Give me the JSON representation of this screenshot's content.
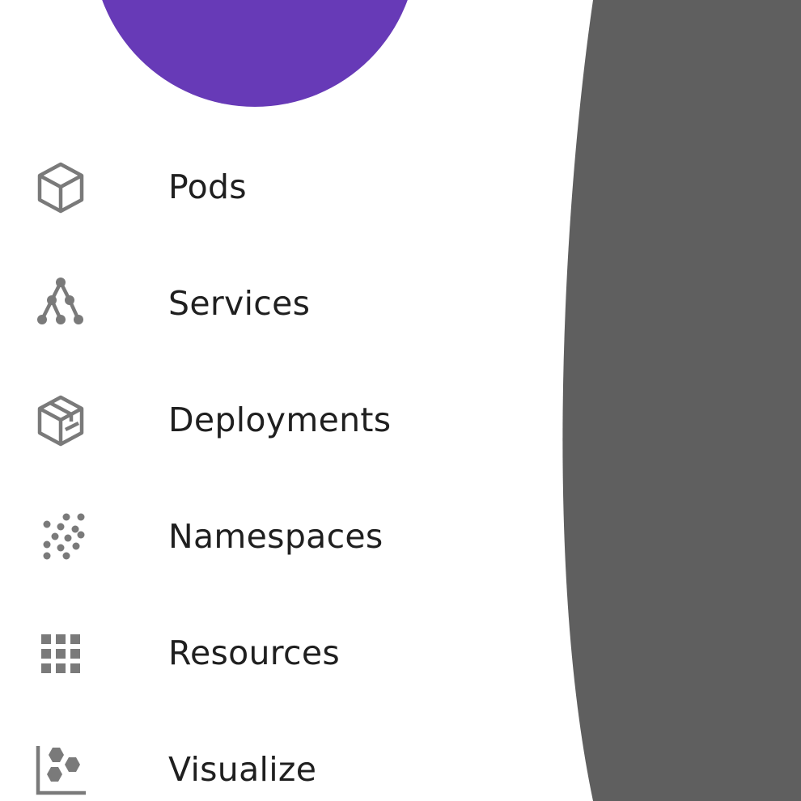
{
  "colors": {
    "accent": "#673ab7",
    "overlay": "#5f5f5f",
    "icon": "#7a7a7a",
    "text": "#1f1f1f",
    "background": "#ffffff"
  },
  "nav": {
    "items": [
      {
        "label": "Pods",
        "icon": "cube-icon"
      },
      {
        "label": "Services",
        "icon": "service-tree-icon"
      },
      {
        "label": "Deployments",
        "icon": "package-icon"
      },
      {
        "label": "Namespaces",
        "icon": "dots-cluster-icon"
      },
      {
        "label": "Resources",
        "icon": "grid-icon"
      },
      {
        "label": "Visualize",
        "icon": "chart-bubbles-icon"
      }
    ]
  }
}
